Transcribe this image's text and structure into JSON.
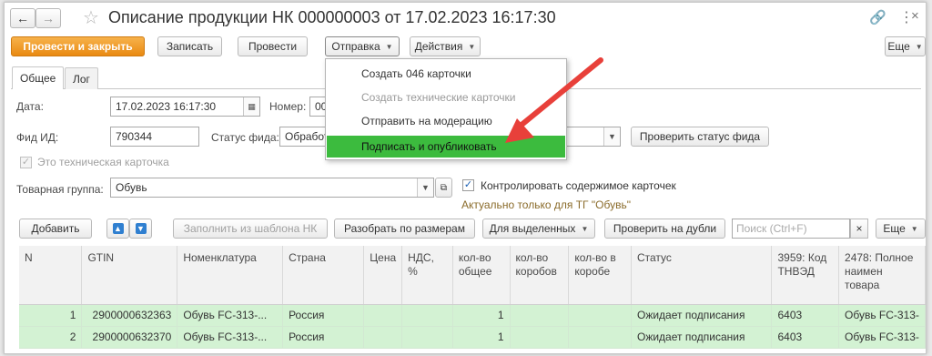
{
  "title": "Описание продукции НК 000000003 от 17.02.2023 16:17:30",
  "toolbar": {
    "post_close": "Провести и закрыть",
    "save": "Записать",
    "post": "Провести",
    "send": "Отправка",
    "actions": "Действия",
    "more": "Еще"
  },
  "tabs": [
    "Общее",
    "Лог"
  ],
  "form": {
    "date_label": "Дата:",
    "date_value": "17.02.2023 16:17:30",
    "number_label": "Номер:",
    "number_value": "00",
    "feed_id_label": "Фид ИД:",
    "feed_id_value": "790344",
    "feed_status_label": "Статус фида:",
    "feed_status_value": "Обработ",
    "check_status_btn": "Проверить статус фида",
    "technical_card_label": "Это техническая карточка",
    "product_group_label": "Товарная группа:",
    "product_group_value": "Обувь",
    "control_content_label": "Контролировать содержимое карточек",
    "control_note": "Актуально только для ТГ \"Обувь\""
  },
  "menu": {
    "items": [
      "Создать 046 карточки",
      "Создать технические карточки",
      "Отправить на модерацию",
      "Подписать и опубликовать"
    ]
  },
  "table_toolbar": {
    "add": "Добавить",
    "fill_template": "Заполнить из шаблона НК",
    "split_sizes": "Разобрать по размерам",
    "for_selected": "Для выделенных",
    "check_duplicates": "Проверить на дубли",
    "search_placeholder": "Поиск (Ctrl+F)",
    "more": "Еще"
  },
  "table": {
    "headers": [
      "N",
      "GTIN",
      "Номенклатура",
      "Страна",
      "Цена",
      "НДС, %",
      "кол-во общее",
      "кол-во коробов",
      "кол-во в коробе",
      "Статус",
      "3959: Код ТНВЭД",
      "2478: Полное наимен товара"
    ],
    "rows": [
      [
        "1",
        "2900000632363",
        "Обувь FC-313-...",
        "Россия",
        "",
        "",
        "1",
        "",
        "",
        "Ожидает подписания",
        "6403",
        "Обувь FC-313-"
      ],
      [
        "2",
        "2900000632370",
        "Обувь FC-313-...",
        "Россия",
        "",
        "",
        "1",
        "",
        "",
        "Ожидает подписания",
        "6403",
        "Обувь FC-313-"
      ]
    ]
  },
  "colors": {
    "primary": "#e98a12",
    "menu_highlight": "#3cbb3e",
    "row_bg": "#d3f2d3",
    "arrow": "#e8403a",
    "note": "#8a6b2a"
  }
}
